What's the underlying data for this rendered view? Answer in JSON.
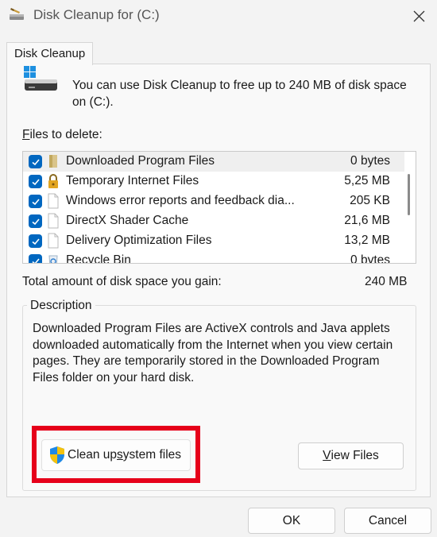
{
  "window": {
    "title": "Disk Cleanup for  (C:)",
    "close_icon": "close-icon"
  },
  "tab": {
    "label": "Disk Cleanup"
  },
  "intro": {
    "text": "You can use Disk Cleanup to free up to 240 MB of disk space on  (C:)."
  },
  "files": {
    "label_prefix": "F",
    "label_rest": "iles to delete:",
    "items": [
      {
        "name": "Downloaded Program Files",
        "size": "0 bytes",
        "checked": true,
        "icon": "folder-icon"
      },
      {
        "name": "Temporary Internet Files",
        "size": "5,25 MB",
        "checked": true,
        "icon": "lock-icon"
      },
      {
        "name": "Windows error reports and feedback dia...",
        "size": "205 KB",
        "checked": true,
        "icon": "file-icon"
      },
      {
        "name": "DirectX Shader Cache",
        "size": "21,6 MB",
        "checked": true,
        "icon": "file-icon"
      },
      {
        "name": "Delivery Optimization Files",
        "size": "13,2 MB",
        "checked": true,
        "icon": "file-icon"
      },
      {
        "name": "Recycle Bin",
        "size": "0 bytes",
        "checked": true,
        "icon": "recycle-bin-icon"
      }
    ]
  },
  "total": {
    "label": "Total amount of disk space you gain:",
    "value": "240 MB"
  },
  "description": {
    "title": "Description",
    "text": "Downloaded Program Files are ActiveX controls and Java applets downloaded automatically from the Internet when you view certain pages. They are temporarily stored in the Downloaded Program Files folder on your hard disk."
  },
  "buttons": {
    "cleanup_pre": "Clean up ",
    "cleanup_ul": "s",
    "cleanup_post": "ystem files",
    "view_ul": "V",
    "view_post": "iew Files",
    "ok": "OK",
    "cancel": "Cancel"
  },
  "colors": {
    "accent": "#0067c0",
    "highlight": "#e6001a",
    "window_bg": "#f3f3f3"
  }
}
